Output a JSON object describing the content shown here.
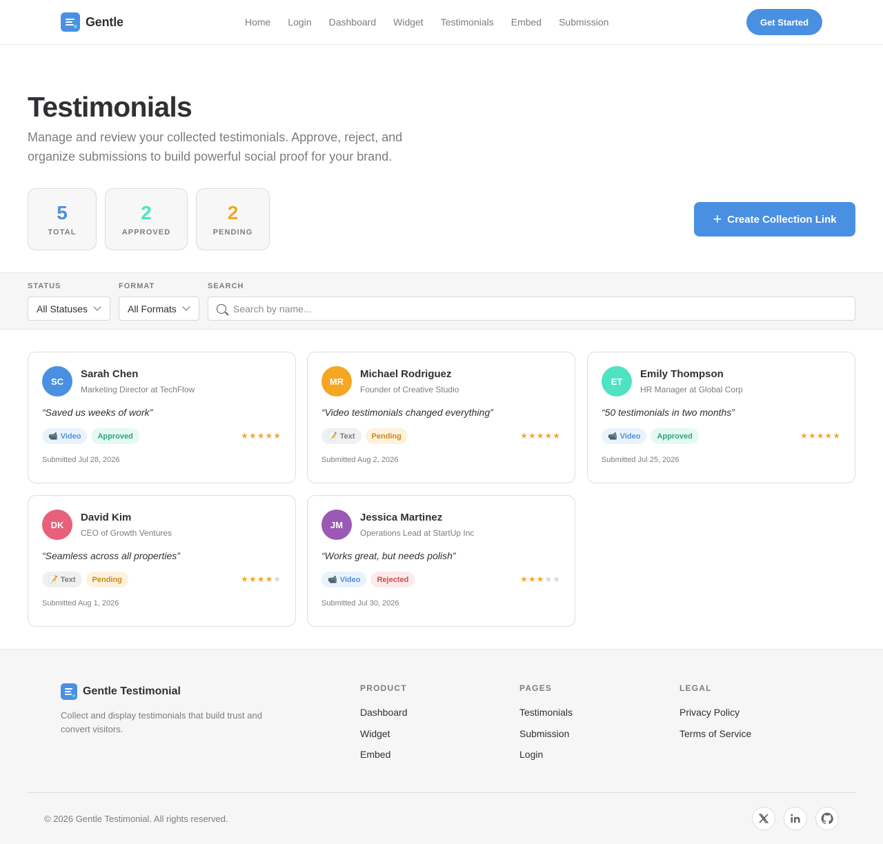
{
  "nav": {
    "brand": "Gentle",
    "links": [
      "Home",
      "Login",
      "Dashboard",
      "Widget",
      "Testimonials",
      "Embed",
      "Submission"
    ],
    "cta": "Get Started"
  },
  "hero": {
    "title": "Testimonials",
    "subtitle": "Manage and review your collected testimonials. Approve, reject, and organize submissions to build powerful social proof for your brand.",
    "stats": {
      "total": {
        "value": "5",
        "label": "TOTAL"
      },
      "approved": {
        "value": "2",
        "label": "APPROVED"
      },
      "pending": {
        "value": "2",
        "label": "PENDING"
      }
    },
    "create_button": "Create Collection Link"
  },
  "filters": {
    "status": {
      "label": "STATUS",
      "value": "All Statuses"
    },
    "format": {
      "label": "FORMAT",
      "value": "All Formats"
    },
    "search": {
      "label": "SEARCH",
      "placeholder": "Search by name..."
    }
  },
  "testimonials": [
    {
      "initials": "SC",
      "avatar_color": "#4a90e2",
      "name": "Sarah Chen",
      "role": "Marketing Director at TechFlow",
      "quote": "“Saved us weeks of work”",
      "format": "Video",
      "format_icon": "video-camera-icon",
      "status": "Approved",
      "rating": 5,
      "submitted": "Submitted Jul 28, 2026"
    },
    {
      "initials": "MR",
      "avatar_color": "#f5a623",
      "name": "Michael Rodriguez",
      "role": "Founder of Creative Studio",
      "quote": "“Video testimonials changed everything”",
      "format": "Text",
      "format_icon": "memo-icon",
      "status": "Pending",
      "rating": 5,
      "submitted": "Submitted Aug 2, 2026"
    },
    {
      "initials": "ET",
      "avatar_color": "#50e3c2",
      "name": "Emily Thompson",
      "role": "HR Manager at Global Corp",
      "quote": "“50 testimonials in two months”",
      "format": "Video",
      "format_icon": "video-camera-icon",
      "status": "Approved",
      "rating": 5,
      "submitted": "Submitted Jul 25, 2026"
    },
    {
      "initials": "DK",
      "avatar_color": "#e8607a",
      "name": "David Kim",
      "role": "CEO of Growth Ventures",
      "quote": "“Seamless across all properties”",
      "format": "Text",
      "format_icon": "memo-icon",
      "status": "Pending",
      "rating": 4,
      "submitted": "Submitted Aug 1, 2026"
    },
    {
      "initials": "JM",
      "avatar_color": "#9b59b6",
      "name": "Jessica Martinez",
      "role": "Operations Lead at StartUp Inc",
      "quote": "“Works great, but needs polish”",
      "format": "Video",
      "format_icon": "video-camera-icon",
      "status": "Rejected",
      "rating": 3,
      "submitted": "Submitted Jul 30, 2026"
    }
  ],
  "footer": {
    "brand": "Gentle Testimonial",
    "description": "Collect and display testimonials that build trust and convert visitors.",
    "columns": [
      {
        "title": "PRODUCT",
        "links": [
          "Dashboard",
          "Widget",
          "Embed"
        ]
      },
      {
        "title": "PAGES",
        "links": [
          "Testimonials",
          "Submission",
          "Login"
        ]
      },
      {
        "title": "LEGAL",
        "links": [
          "Privacy Policy",
          "Terms of Service"
        ]
      }
    ],
    "copyright": "© 2026 Gentle Testimonial. All rights reserved.",
    "socials": [
      "x-icon",
      "linkedin-icon",
      "github-icon"
    ]
  },
  "colors": {
    "primary": "#4a90e2",
    "approved": "#50e3c2",
    "pending": "#f5a623",
    "rejected": "#d14b4b",
    "star": "#f5a623"
  }
}
